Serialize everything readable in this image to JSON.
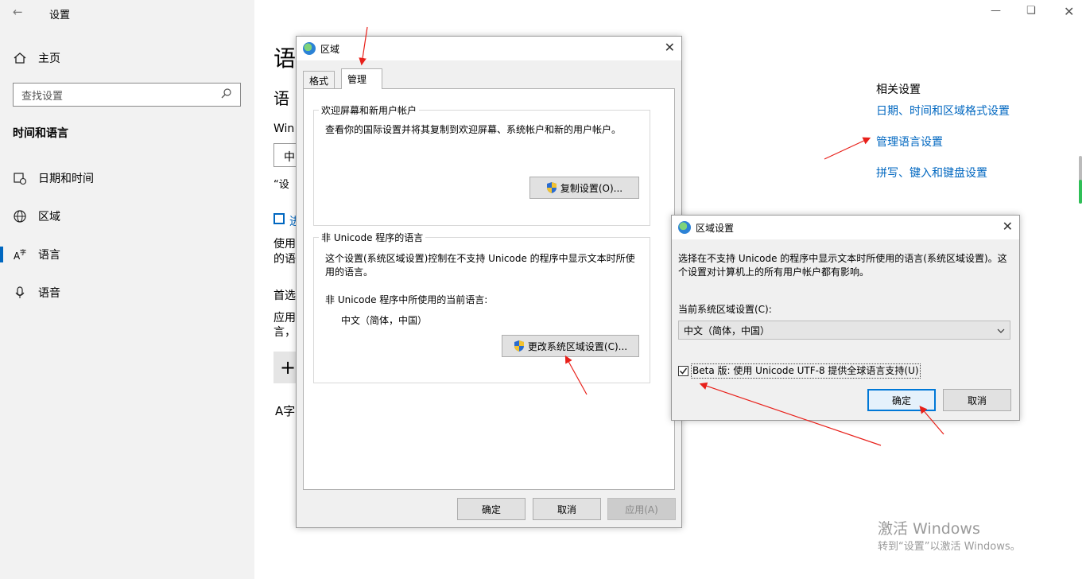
{
  "settings": {
    "app_title": "设置",
    "home_label": "主页",
    "search_placeholder": "查找设置",
    "section_title": "时间和语言",
    "nav": [
      {
        "label": "日期和时间",
        "icon": "calendar-clock-icon"
      },
      {
        "label": "区域",
        "icon": "globe-icon"
      },
      {
        "label": "语言",
        "icon": "language-icon"
      },
      {
        "label": "语音",
        "icon": "microphone-icon"
      }
    ],
    "main_fragments": {
      "heading": "语",
      "subheading": "语",
      "line1": "Win",
      "combo": "中",
      "quote": "“设",
      "link": "进",
      "p1a": "使用",
      "p1b": "的语",
      "pref": "首选",
      "p2a": "应用",
      "p2b": "言，",
      "plus": "+",
      "lang_icon_text": "A字"
    },
    "related": {
      "title": "相关设置",
      "links": [
        "日期、时间和区域格式设置",
        "管理语言设置",
        "拼写、键入和键盘设置"
      ]
    },
    "activate": {
      "line1": "激活 Windows",
      "line2": "转到“设置”以激活 Windows。"
    }
  },
  "region_dialog": {
    "title": "区域",
    "tabs": [
      "格式",
      "管理"
    ],
    "welcome_group": {
      "label": "欢迎屏幕和新用户帐户",
      "desc": "查看你的国际设置并将其复制到欢迎屏幕、系统帐户和新的用户帐户。",
      "button": "复制设置(O)..."
    },
    "unicode_group": {
      "label": "非 Unicode 程序的语言",
      "desc": "这个设置(系统区域设置)控制在不支持 Unicode 的程序中显示文本时所使用的语言。",
      "current_label": "非 Unicode 程序中所使用的当前语言:",
      "current_value": "中文（简体，中国）",
      "button": "更改系统区域设置(C)..."
    },
    "ok": "确定",
    "cancel": "取消",
    "apply": "应用(A)"
  },
  "locale_dialog": {
    "title": "区域设置",
    "desc": "选择在不支持 Unicode 的程序中显示文本时所使用的语言(系统区域设置)。这个设置对计算机上的所有用户帐户都有影响。",
    "current_label": "当前系统区域设置(C):",
    "current_value": "中文（简体，中国）",
    "beta_label": "Beta 版: 使用 Unicode UTF-8 提供全球语言支持(U)",
    "beta_checked": true,
    "ok": "确定",
    "cancel": "取消"
  },
  "colors": {
    "accent": "#0067c0",
    "annotation": "#e8201a"
  }
}
